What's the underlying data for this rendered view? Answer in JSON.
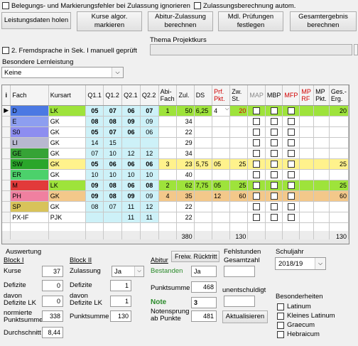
{
  "top_checks": [
    {
      "label": "Belegungs- und Markierungsfehler bei Zulassung ignorieren",
      "checked": false
    },
    {
      "label": "Zulassungsberechnung autom.",
      "checked": false
    }
  ],
  "buttons": {
    "leistungsdaten": "Leistungsdaten holen",
    "kurse_markieren": "Kurse algor. markieren",
    "abitur_zulassung": "Abitur-Zulassung berechnen",
    "mdl_pruefungen": "Mdl. Prüfungen festlegen",
    "gesamtergebnis": "Gesamtergebnis berechnen",
    "freiw_ruecktritt": "Freiw. Rücktritt",
    "aktualisieren": "Aktualisieren"
  },
  "fremdsprache_label": "2. Fremdsprache in Sek. I manuell geprüft",
  "thema_label": "Thema Projektkurs",
  "thema_value": "",
  "besondere_label": "Besondere Lernleistung",
  "besondere_value": "Keine",
  "table": {
    "corner": "i",
    "headers": [
      "Fach",
      "Kursart",
      "Q1.1",
      "Q1.2",
      "Q2.1",
      "Q2.2",
      "Abi-Fach",
      "Zul.",
      "DS",
      "Prf. Pkt.",
      "Zw. St.",
      "MAP",
      "MBP",
      "MFP",
      "MP RF",
      "MP Pkt.",
      "Ges.-Erg."
    ],
    "rows": [
      {
        "fach": "D",
        "color": "#4b79e3",
        "kursart": "LK",
        "q": [
          "05",
          "07",
          "06",
          "07"
        ],
        "bold": [
          true,
          true,
          true,
          true
        ],
        "abifach": "1",
        "zul": "50",
        "ds": "6,25",
        "prf": "4",
        "zw": "20",
        "ges": "20",
        "bg": "#9ee33b",
        "current": true
      },
      {
        "fach": "E",
        "color": "#8d9ef0",
        "kursart": "GK",
        "q": [
          "08",
          "08",
          "09",
          "09"
        ],
        "bold": [
          true,
          true,
          true,
          false
        ],
        "abifach": "",
        "zul": "34",
        "ds": "",
        "prf": "",
        "zw": "",
        "ges": "",
        "bg": "#ffffff"
      },
      {
        "fach": "S0",
        "color": "#8d8df0",
        "kursart": "GK",
        "q": [
          "05",
          "07",
          "06",
          "06"
        ],
        "bold": [
          true,
          true,
          true,
          false
        ],
        "abifach": "",
        "zul": "22",
        "ds": "",
        "prf": "",
        "zw": "",
        "ges": "",
        "bg": "#ffffff"
      },
      {
        "fach": "LI",
        "color": "#b8b8d0",
        "kursart": "GK",
        "q": [
          "14",
          "15",
          "",
          ""
        ],
        "bold": [
          false,
          false,
          false,
          false
        ],
        "abifach": "",
        "zul": "29",
        "ds": "",
        "prf": "",
        "zw": "",
        "ges": "",
        "bg": "#ffffff"
      },
      {
        "fach": "GE",
        "color": "#36a336",
        "kursart": "GK",
        "q": [
          "07",
          "10",
          "12",
          "12"
        ],
        "bold": [
          false,
          false,
          false,
          false
        ],
        "abifach": "",
        "zul": "34",
        "ds": "",
        "prf": "",
        "zw": "",
        "ges": "",
        "bg": "#ffffff"
      },
      {
        "fach": "SW",
        "color": "#2aa62a",
        "kursart": "GK",
        "q": [
          "05",
          "06",
          "06",
          "06"
        ],
        "bold": [
          true,
          true,
          true,
          true
        ],
        "abifach": "3",
        "zul": "23",
        "ds": "5,75",
        "prf": "05",
        "zw": "25",
        "ges": "25",
        "bg": "#fff28c"
      },
      {
        "fach": "ER",
        "color": "#4cd16b",
        "kursart": "GK",
        "q": [
          "10",
          "10",
          "10",
          "10"
        ],
        "bold": [
          false,
          false,
          false,
          false
        ],
        "abifach": "",
        "zul": "40",
        "ds": "",
        "prf": "",
        "zw": "",
        "ges": "",
        "bg": "#ffffff"
      },
      {
        "fach": "M",
        "color": "#e23a3a",
        "kursart": "LK",
        "q": [
          "09",
          "08",
          "06",
          "08"
        ],
        "bold": [
          true,
          true,
          true,
          true
        ],
        "abifach": "2",
        "zul": "62",
        "ds": "7,75",
        "prf": "05",
        "zw": "25",
        "ges": "25",
        "bg": "#9ee33b"
      },
      {
        "fach": "PH",
        "color": "#f080a0",
        "kursart": "GK",
        "q": [
          "09",
          "08",
          "09",
          "09"
        ],
        "bold": [
          true,
          true,
          true,
          false
        ],
        "abifach": "4",
        "zul": "35",
        "ds": "",
        "prf": "12",
        "zw": "60",
        "ges": "60",
        "bg": "#f3c88a"
      },
      {
        "fach": "SP",
        "color": "#d8c35a",
        "kursart": "GK",
        "q": [
          "08",
          "07",
          "11",
          "12"
        ],
        "bold": [
          false,
          false,
          false,
          false
        ],
        "abifach": "",
        "zul": "22",
        "ds": "",
        "prf": "",
        "zw": "",
        "ges": "",
        "bg": "#ffffff"
      },
      {
        "fach": "PX-IF",
        "color": "#ffffff",
        "kursart": "PJK",
        "q": [
          "",
          "",
          "11",
          "11"
        ],
        "bold": [
          false,
          false,
          false,
          false
        ],
        "abifach": "",
        "zul": "22",
        "ds": "",
        "prf": "",
        "zw": "",
        "ges": "",
        "bg": "#ffffff"
      }
    ],
    "totals": {
      "zul": "380",
      "zw": "130",
      "ges": "130"
    }
  },
  "auswertung": {
    "title": "Auswertung",
    "block1": {
      "title": "Block I",
      "kurse_label": "Kurse",
      "kurse": "37",
      "defizite_label": "Defizite",
      "defizite": "0",
      "davon_lk_label": "davon Defizite LK",
      "davon_lk": "0",
      "normierte_label": "normierte Punktsumme",
      "normierte": "338",
      "durchschnitt_label": "Durchschnitt",
      "durchschnitt": "8,44"
    },
    "block2": {
      "title": "Block II",
      "zulassung_label": "Zulassung",
      "zulassung": "Ja",
      "defizite_label": "Defizite",
      "defizite": "1",
      "davon_lk_label": "davon Defizite LK",
      "davon_lk": "1",
      "punktsumme_label": "Punktsumme",
      "punktsumme": "130"
    },
    "abitur": {
      "title": "Abitur",
      "bestanden_label": "Bestanden",
      "bestanden": "Ja",
      "punktsumme_label": "Punktsumme",
      "punktsumme": "468",
      "note_label": "Note",
      "note": "3",
      "notensprung_label": "Notensprung ab Punkte",
      "notensprung": "481"
    },
    "fehlstunden_title": "Fehlstunden",
    "gesamtzahl_label": "Gesamtzahl",
    "gesamtzahl": "",
    "unentschuldigt_label": "unentschuldigt",
    "unentschuldigt": ""
  },
  "schuljahr": {
    "label": "Schuljahr",
    "value": "2018/19"
  },
  "besonderheiten": {
    "label": "Besonderheiten",
    "items": [
      "Latinum",
      "Kleines Latinum",
      "Graecum",
      "Hebraicum"
    ]
  }
}
